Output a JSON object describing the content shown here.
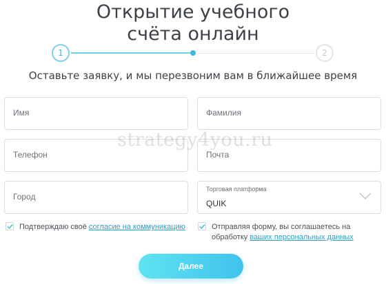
{
  "header": {
    "title_line1": "Открытие учебного",
    "title_line2": "счёта онлайн",
    "subtitle": "Оставьте заявку, и мы перезвоним вам в ближайшее время"
  },
  "steps": {
    "step1_label": "1",
    "step2_label": "2",
    "active_color": "#3fb6d3",
    "inactive_color": "#c4c9ce"
  },
  "form": {
    "name_placeholder": "Имя",
    "surname_placeholder": "Фамилия",
    "phone_placeholder": "Телефон",
    "email_placeholder": "Почта",
    "city_placeholder": "Город",
    "platform_label": "Торговая платформа",
    "platform_value": "QUIK"
  },
  "consents": {
    "c1_text": "Подтверждаю своё ",
    "c1_link": "согласие на коммуникацию",
    "c1_checked": true,
    "c2_text_line1": "Отправляя форму, вы соглашаетесь на",
    "c2_text_line2": "обработку ",
    "c2_link": "ваших персональных данных",
    "c2_checked": true
  },
  "actions": {
    "next_label": "Далее",
    "accent_color": "#3fc3ee"
  },
  "watermark": "strategy4you.ru"
}
